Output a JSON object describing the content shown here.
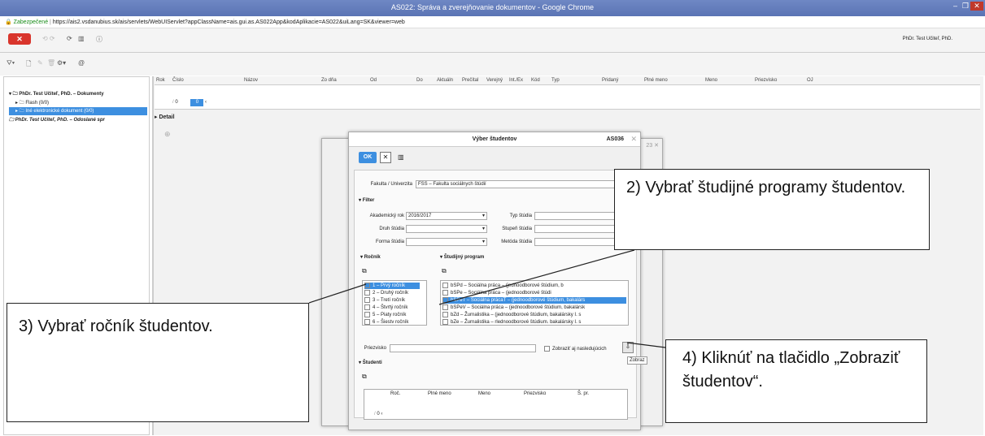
{
  "window": {
    "title": "AS022: Správa a zverejňovanie dokumentov - Google Chrome"
  },
  "address": {
    "secure_label": "Zabezpečené",
    "url": "https://ais2.vsdanubius.sk/ais/servlets/WebUIServlet?appClassName=ais.gui.as.AS022App&kodAplikacie=AS022&uiLang=SK&viewer=web"
  },
  "toolbar": {
    "user": "PhDr. Test Učiteľ, PhD."
  },
  "tree": {
    "root": "PhDr. Test Učiteľ, PhD. – Dokumenty",
    "flash": "Flash (0/0)",
    "other": "Iné elektronické dokument (0/0)",
    "sent": "PhDr. Test Učiteľ, PhD. – Odoslané spr"
  },
  "grid": {
    "columns": [
      "Rok",
      "Číslo",
      "Názov",
      "Zo dňa",
      "Od",
      "Do",
      "Aktuáln",
      "Prečítal",
      "Verejný",
      "Int./Ex",
      "Kód",
      "Typ",
      "Pridaný",
      "Plné meno",
      "Meno",
      "Priezvisko",
      "OJ"
    ],
    "pager_value": "0",
    "pager_box": "0"
  },
  "detail": {
    "label": "Detail"
  },
  "dialog": {
    "title": "Výber študentov",
    "code": "AS036",
    "ok": "OK",
    "fakulta_label": "Fakulta / Univerzita",
    "fakulta_value": "FSS – Fakulta sociálnych štúdií",
    "filter": "Filter",
    "akad_label": "Akademický rok",
    "akad_value": "2016/2017",
    "druh_label": "Druh štúdia",
    "forma_label": "Forma štúdia",
    "typ_label": "Typ štúdia",
    "stupen_label": "Stupeň štúdia",
    "metoda_label": "Metóda štúdia",
    "rocnik_section": "Ročník",
    "program_section": "Študijný program",
    "rocniky": [
      "1 – Prvý ročník",
      "2 – Druhý ročník",
      "3 – Tretí ročník",
      "4 – Štvrtý ročník",
      "5 – Piaty ročník",
      "6 – Šiestv ročník"
    ],
    "programy": [
      "bSPd – Sociálna práca – (jednoodborové štúdium, b",
      "bSPe – Sociálna práca – (jednoodborové štúdi",
      "bSPeT – Sociálna prácaT – (jednoodborové štúdium, bakalárs",
      "bSPeV – Sociálna práca – (jednoodborové štúdium, bakalársk",
      "bZd – Žurnalistika – (jednoodborové štúdium, bakalársky I. s",
      "bZe – Žurnalistika – rlednoodborové štúdium. bakalársky I. s"
    ],
    "priezvisko_label": "Priezvisko",
    "show_following": "Zobraziť aj nasledujúcich",
    "studenti_section": "Študenti",
    "st_cols": [
      "Roč.",
      "Plné meno",
      "Meno",
      "Priezvisko",
      "Š. pr."
    ],
    "st_pager": "0",
    "tooltip": "Zobraz"
  },
  "callouts": {
    "c2": "2) Vybrať študijné programy študentov.",
    "c3": "3) Vybrať ročník študentov.",
    "c4": "4) Kliknúť na tlačidlo „Zobraziť študentov“."
  },
  "colors": {
    "accent": "#3d8fe0",
    "titlebar": "#5a74b4",
    "close": "#d9352c"
  }
}
